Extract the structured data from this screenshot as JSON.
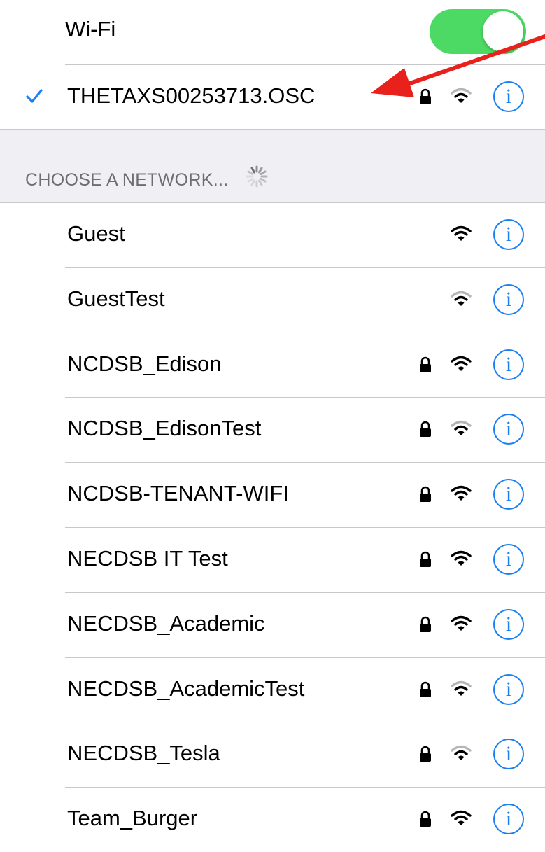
{
  "wifi": {
    "label": "Wi-Fi",
    "enabled": true,
    "toggle_color": "#4cd964"
  },
  "current_network": {
    "name": "THETAXS00253713.OSC",
    "connected": true,
    "secured": true,
    "signal": "medium",
    "info_label": "i"
  },
  "section": {
    "header": "CHOOSE A NETWORK...",
    "loading": true
  },
  "networks": [
    {
      "name": "Guest",
      "secured": false,
      "signal": "full",
      "info_label": "i"
    },
    {
      "name": "GuestTest",
      "secured": false,
      "signal": "medium",
      "info_label": "i"
    },
    {
      "name": "NCDSB_Edison",
      "secured": true,
      "signal": "full",
      "info_label": "i"
    },
    {
      "name": "NCDSB_EdisonTest",
      "secured": true,
      "signal": "medium",
      "info_label": "i"
    },
    {
      "name": "NCDSB-TENANT-WIFI",
      "secured": true,
      "signal": "full",
      "info_label": "i"
    },
    {
      "name": "NECDSB IT Test",
      "secured": true,
      "signal": "full",
      "info_label": "i"
    },
    {
      "name": "NECDSB_Academic",
      "secured": true,
      "signal": "full",
      "info_label": "i"
    },
    {
      "name": "NECDSB_AcademicTest",
      "secured": true,
      "signal": "medium",
      "info_label": "i"
    },
    {
      "name": "NECDSB_Tesla",
      "secured": true,
      "signal": "medium",
      "info_label": "i"
    },
    {
      "name": "Team_Burger",
      "secured": true,
      "signal": "full",
      "info_label": "i"
    }
  ],
  "colors": {
    "accent": "#1a7ff0",
    "annotation_arrow": "#e8211d"
  },
  "icons": {
    "check": "checkmark-icon",
    "lock": "lock-icon",
    "wifi": "wifi-signal-icon",
    "info": "info-icon",
    "spinner": "spinner-icon"
  }
}
